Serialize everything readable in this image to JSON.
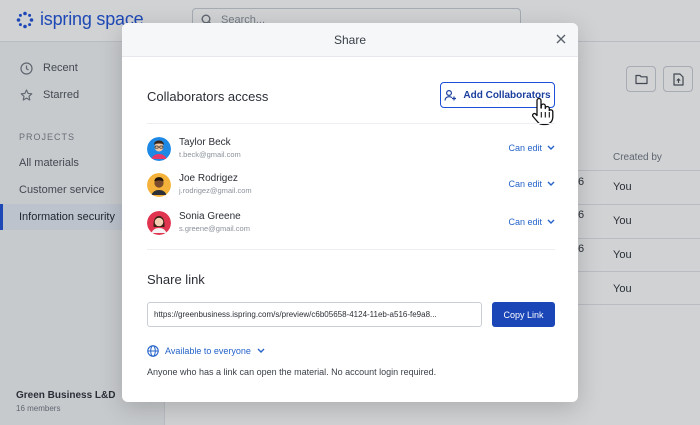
{
  "app": {
    "logo_text": "ispring space",
    "search_placeholder": "Search...",
    "sidebar": {
      "recent": "Recent",
      "starred": "Starred",
      "projects_heading": "PROJECTS",
      "projects": [
        "All materials",
        "Customer service",
        "Information security"
      ],
      "org_name": "Green Business L&D",
      "org_members": "16 members"
    },
    "table": {
      "created_by_header": "Created by",
      "rows": [
        {
          "partial": "6",
          "created_by": "You"
        },
        {
          "partial": "6",
          "created_by": "You"
        },
        {
          "partial": "6",
          "created_by": "You"
        },
        {
          "partial": "",
          "created_by": "You"
        }
      ]
    }
  },
  "modal": {
    "title": "Share",
    "collaborators_title": "Collaborators access",
    "add_button": "Add Collaborators",
    "collaborators": [
      {
        "name": "Taylor Beck",
        "email": "t.beck@gmail.com",
        "permission": "Can edit",
        "avatar_bg": "#1e88e5"
      },
      {
        "name": "Joe Rodrigez",
        "email": "j.rodrigez@gmail.com",
        "permission": "Can edit",
        "avatar_bg": "#f4b23a"
      },
      {
        "name": "Sonia Greene",
        "email": "s.greene@gmail.com",
        "permission": "Can edit",
        "avatar_bg": "#e0344f"
      }
    ],
    "share_link_title": "Share link",
    "link_url": "https://greenbusiness.ispring.com/s/preview/c6b05658-4124-11eb-a516-fe9a8...",
    "copy_button": "Copy Link",
    "availability": "Available to everyone",
    "note": "Anyone who has a link can open the material. No account login required."
  },
  "colors": {
    "accent": "#1b4fd8",
    "link": "#2563c9",
    "primary_button": "#1a46b8"
  }
}
